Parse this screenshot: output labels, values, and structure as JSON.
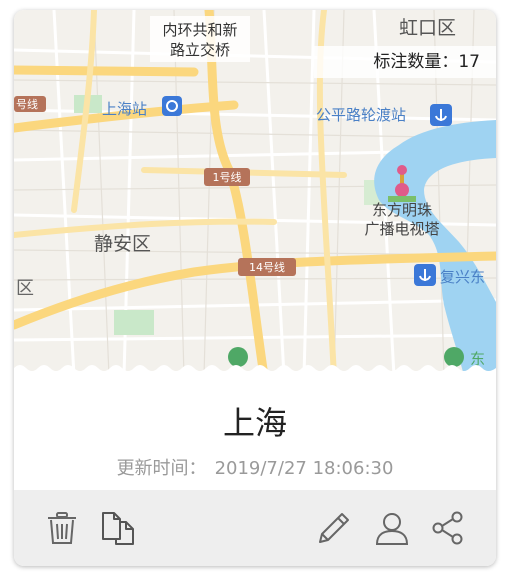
{
  "map": {
    "labels": {
      "neihuan": "内环共和新",
      "neihuan2": "路立交桥",
      "hongkou": "虹口区",
      "shanghai_station": "上海站",
      "gongping": "公平路轮渡站",
      "line_left": "号线",
      "line1": "1号线",
      "line14": "14号线",
      "jingan": "静安区",
      "pearl1": "东方明珠",
      "pearl2": "广播电视塔",
      "fuxing": "复兴东",
      "qu_left": "区",
      "dong": "东"
    },
    "annotation_count_label": "标注数量：",
    "annotation_count": "17"
  },
  "card": {
    "title": "上海",
    "updated_label": "更新时间：",
    "updated_value": "2019/7/27 18:06:30"
  },
  "colors": {
    "accent_icon": "#666666",
    "water": "#9fd3f2",
    "road_major": "#fbd77e"
  }
}
